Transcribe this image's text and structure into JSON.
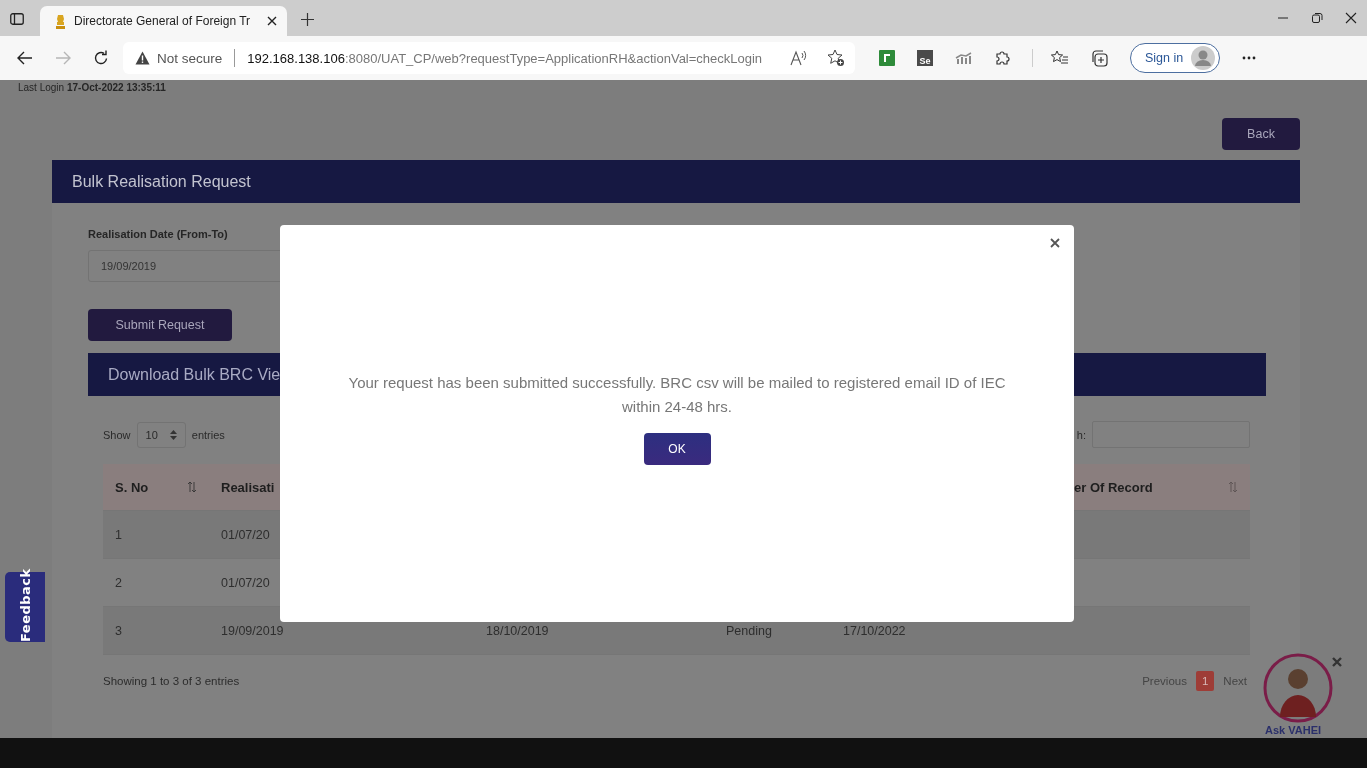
{
  "browser": {
    "tab": {
      "title": "Directorate General of Foreign Tr"
    },
    "nav": {
      "forward_enabled": false
    },
    "address": {
      "warning": "Not secure",
      "host": "192.168.138.106",
      "path": ":8080/UAT_CP/web?requestType=ApplicationRH&actionVal=checkLogin"
    },
    "extension_text": "Se",
    "sign_in": "Sign in"
  },
  "last_login": {
    "label": "Last Login",
    "value": "17-Oct-2022 13:35:11"
  },
  "back_button": "Back",
  "panel": {
    "title": "Bulk Realisation Request",
    "date_label": "Realisation Date (From-To)",
    "date_from": "19/09/2019",
    "submit": "Submit Request"
  },
  "download_section": {
    "title": "Download Bulk BRC Vie",
    "show_label": "Show",
    "page_size": "10",
    "entries_label": "entries",
    "search_label": "h:",
    "header": {
      "column_1": "S. No",
      "column_2": "Realisati",
      "column_6": "er Of Record"
    },
    "rows": [
      {
        "cells": [
          "1",
          "01/07/20"
        ]
      },
      {
        "cells": [
          "2",
          "01/07/20"
        ]
      },
      {
        "cells": [
          "3",
          "19/09/2019",
          "18/10/2019",
          "Pending",
          "17/10/2022"
        ]
      }
    ],
    "info": "Showing 1 to 3 of 3 entries",
    "pagination": [
      {
        "label": "Previous",
        "selected": false
      },
      {
        "label": "1",
        "selected": true
      },
      {
        "label": "Next",
        "selected": false
      }
    ]
  },
  "feedback": "Feedback",
  "assistant": {
    "label": "Ask VAHEI"
  },
  "modal": {
    "message": "Your request has been submitted successfully. BRC csv will be mailed to registered email ID of IEC within 24-48 hrs.",
    "ok": "OK"
  }
}
